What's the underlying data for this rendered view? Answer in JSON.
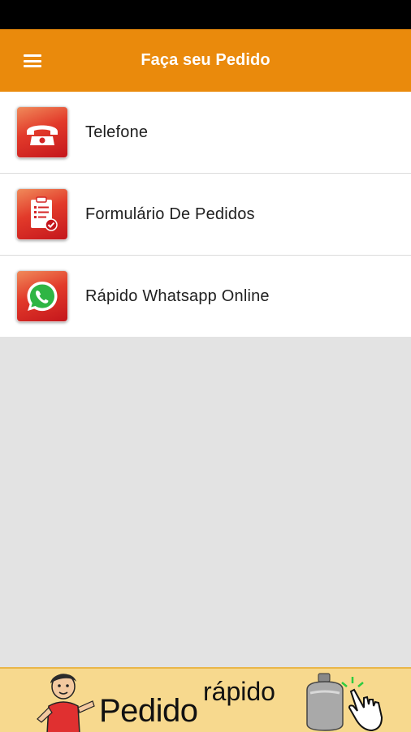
{
  "app_bar": {
    "title": "Faça seu Pedido",
    "color": "#ea8a0c"
  },
  "menu": {
    "items": [
      {
        "label": "Telefone",
        "icon": "phone-icon"
      },
      {
        "label": "Formulário De Pedidos",
        "icon": "clipboard-icon"
      },
      {
        "label": "Rápido Whatsapp Online",
        "icon": "whatsapp-icon"
      }
    ]
  },
  "banner": {
    "word_main": "Pedido",
    "word_small": "rápido",
    "background": "#f7d98e"
  }
}
